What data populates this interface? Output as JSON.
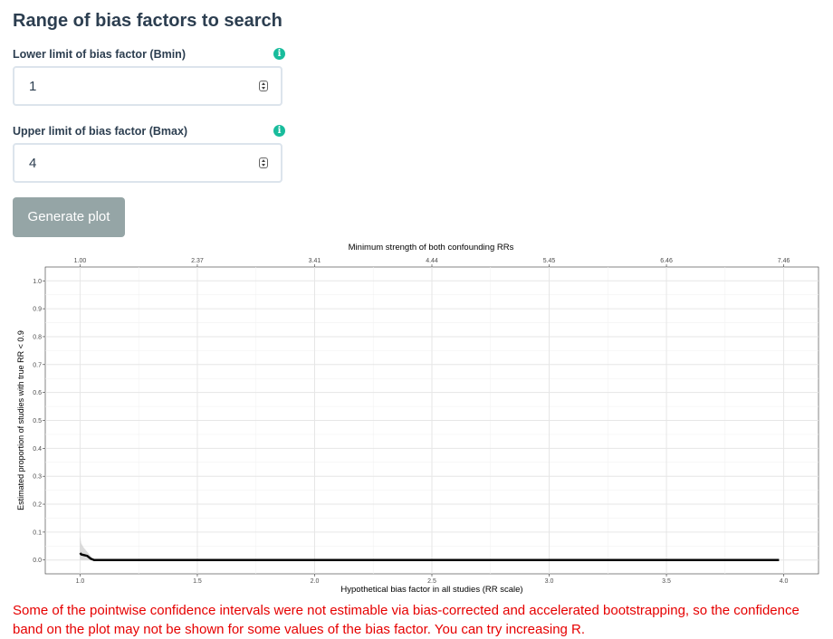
{
  "section_title": "Range of bias factors to search",
  "inputs": [
    {
      "label": "Lower limit of bias factor (Bmin)",
      "value": "1",
      "info_icon": "info-circle-icon"
    },
    {
      "label": "Upper limit of bias factor (Bmax)",
      "value": "4",
      "info_icon": "info-circle-icon"
    }
  ],
  "generate_button": {
    "label": "Generate plot"
  },
  "colors": {
    "accent": "#18bc9c",
    "button": "#95a5a6",
    "warning": "#e60000",
    "text": "#2c3e50"
  },
  "chart_data": {
    "type": "line",
    "title": "",
    "xlabel": "Hypothetical bias factor in all studies (RR scale)",
    "ylabel": "Estimated proportion of studies with true RR < 0.9",
    "top_axis_label": "Minimum strength of both confounding RRs",
    "xlim": [
      1,
      4
    ],
    "ylim": [
      0,
      1
    ],
    "x_ticks": [
      "1.0",
      "1.5",
      "2.0",
      "2.5",
      "3.0",
      "3.5",
      "4.0"
    ],
    "x_tick_values": [
      1.0,
      1.5,
      2.0,
      2.5,
      3.0,
      3.5,
      4.0
    ],
    "y_ticks": [
      "0.0",
      "0.1",
      "0.2",
      "0.3",
      "0.4",
      "0.5",
      "0.6",
      "0.7",
      "0.8",
      "0.9",
      "1.0"
    ],
    "y_tick_values": [
      0.0,
      0.1,
      0.2,
      0.3,
      0.4,
      0.5,
      0.6,
      0.7,
      0.8,
      0.9,
      1.0
    ],
    "top_ticks": [
      "1.00",
      "2.37",
      "3.41",
      "4.44",
      "5.45",
      "6.46",
      "7.46"
    ],
    "top_tick_positions": [
      1.0,
      1.5,
      2.0,
      2.5,
      3.0,
      3.5,
      4.0
    ],
    "grid": true,
    "series": [
      {
        "x": [
          1.0,
          1.005,
          1.015,
          1.03,
          1.045,
          1.06,
          1.5,
          2.0,
          2.5,
          3.0,
          3.5,
          3.98
        ],
        "y": [
          0.025,
          0.02,
          0.018,
          0.015,
          0.005,
          0.0,
          0.0,
          0.0,
          0.0,
          0.0,
          0.0,
          0.0
        ],
        "color": "#000000"
      }
    ],
    "band": {
      "x": [
        1.0,
        1.005,
        1.015,
        1.03,
        1.045,
        1.06
      ],
      "lower": [
        0.0,
        0.0,
        0.0,
        0.0,
        0.0,
        0.0
      ],
      "upper": [
        0.085,
        0.06,
        0.045,
        0.03,
        0.015,
        0.0
      ],
      "color": "#cccccc"
    }
  },
  "warning_text": "Some of the pointwise confidence intervals were not estimable via bias-corrected and accelerated bootstrapping, so the confidence band on the plot may not be shown for some values of the bias factor. You can try increasing R."
}
